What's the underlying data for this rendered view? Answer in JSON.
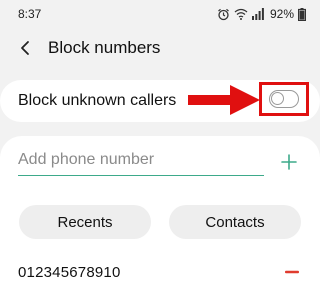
{
  "status_bar": {
    "time": "8:37",
    "battery": "92%",
    "icons": [
      "alarm-icon",
      "wifi-icon",
      "signal-icon",
      "battery-icon"
    ]
  },
  "header": {
    "title": "Block numbers",
    "back_icon": "back-chevron-icon"
  },
  "block_unknown": {
    "label": "Block unknown callers",
    "toggle_on": false
  },
  "add_number": {
    "placeholder": "Add phone number",
    "value": "",
    "add_icon": "plus-icon"
  },
  "buttons": {
    "recents": "Recents",
    "contacts": "Contacts"
  },
  "blocked_list": [
    {
      "number": "012345678910",
      "remove_icon": "minus-icon"
    }
  ],
  "colors": {
    "accent_green": "#3daa8a",
    "annotation_red": "#e01010",
    "remove_red": "#e03b2e"
  }
}
